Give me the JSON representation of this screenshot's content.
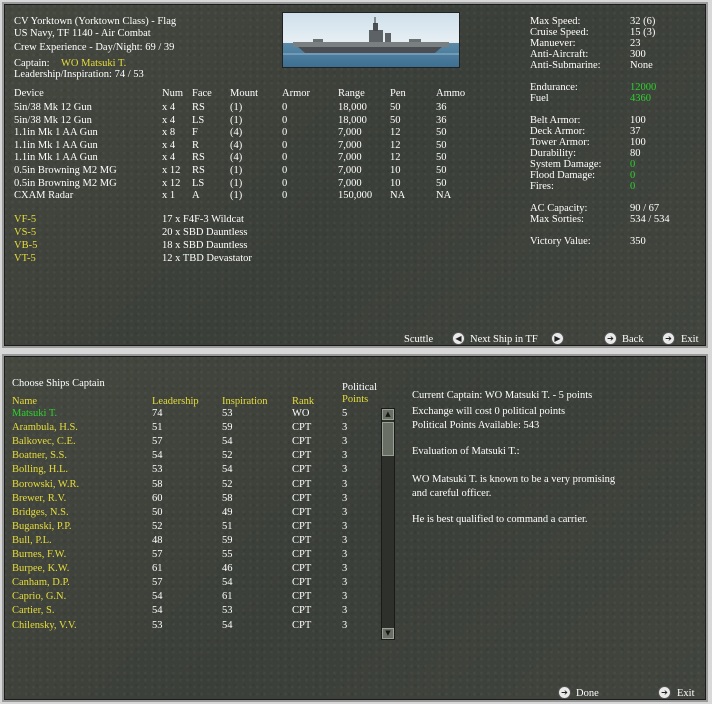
{
  "ship": {
    "title": "CV Yorktown (Yorktown Class) - Flag",
    "subtitle": "US Navy, TF 1140 - Air Combat",
    "crew_exp": "Crew Experience - Day/Night: 69 / 39",
    "captain_label": "Captain:",
    "captain_name": "WO Matsuki T.",
    "leadership": "Leadership/Inspiration: 74 / 53"
  },
  "stats": [
    {
      "label": "Max Speed:",
      "value": "32 (6)",
      "value_color": "white"
    },
    {
      "label": "Cruise Speed:",
      "value": "15 (3)",
      "value_color": "white"
    },
    {
      "label": "Manuever:",
      "value": "23",
      "value_color": "white"
    },
    {
      "label": "Anti-Aircraft:",
      "value": "300",
      "value_color": "white"
    },
    {
      "label": "Anti-Submarine:",
      "value": "None",
      "value_color": "white"
    },
    {
      "label": "Endurance:",
      "value": "12000",
      "value_color": "green"
    },
    {
      "label": "Fuel",
      "value": "4360",
      "value_color": "green"
    },
    {
      "label": "Belt Armor:",
      "value": "100",
      "value_color": "white"
    },
    {
      "label": "Deck Armor:",
      "value": "37",
      "value_color": "white"
    },
    {
      "label": "Tower Armor:",
      "value": "100",
      "value_color": "white"
    },
    {
      "label": "Durability:",
      "value": "80",
      "value_color": "white"
    },
    {
      "label": "System Damage:",
      "value": "0",
      "value_color": "green"
    },
    {
      "label": "Flood Damage:",
      "value": "0",
      "value_color": "green"
    },
    {
      "label": "Fires:",
      "value": "0",
      "value_color": "green"
    },
    {
      "label": "AC Capacity:",
      "value": "90 / 67",
      "value_color": "white"
    },
    {
      "label": "Max Sorties:",
      "value": "534 / 534",
      "value_color": "white"
    },
    {
      "label": "Victory Value:",
      "value": "350",
      "value_color": "white"
    }
  ],
  "devices_header": [
    "Device",
    "Num",
    "Face",
    "Mount",
    "Armor",
    "Range",
    "Pen",
    "Ammo"
  ],
  "devices": [
    [
      "5in/38 Mk 12 Gun",
      "x 4",
      "RS",
      "(1)",
      "0",
      "18,000",
      "50",
      "36"
    ],
    [
      "5in/38 Mk 12 Gun",
      "x 4",
      "LS",
      "(1)",
      "0",
      "18,000",
      "50",
      "36"
    ],
    [
      "1.1in Mk 1 AA Gun",
      "x 8",
      "F",
      "(4)",
      "0",
      "7,000",
      "12",
      "50"
    ],
    [
      "1.1in Mk 1 AA Gun",
      "x 4",
      "R",
      "(4)",
      "0",
      "7,000",
      "12",
      "50"
    ],
    [
      "1.1in Mk 1 AA Gun",
      "x 4",
      "RS",
      "(4)",
      "0",
      "7,000",
      "12",
      "50"
    ],
    [
      "0.5in Browning M2 MG",
      "x 12",
      "RS",
      "(1)",
      "0",
      "7,000",
      "10",
      "50"
    ],
    [
      "0.5in Browning M2 MG",
      "x 12",
      "LS",
      "(1)",
      "0",
      "7,000",
      "10",
      "50"
    ],
    [
      "CXAM Radar",
      "x 1",
      "A",
      "(1)",
      "0",
      "150,000",
      "NA",
      "NA"
    ]
  ],
  "squadrons": [
    {
      "name": "VF-5",
      "desc": "17 x F4F-3 Wildcat"
    },
    {
      "name": "VS-5",
      "desc": "20 x SBD Dauntless"
    },
    {
      "name": "VB-5",
      "desc": "18 x SBD Dauntless"
    },
    {
      "name": "VT-5",
      "desc": "12 x TBD Devastator"
    }
  ],
  "top_buttons": {
    "scuttle": "Scuttle",
    "next_ship": "Next Ship in TF",
    "back": "Back",
    "exit": "Exit"
  },
  "captains": {
    "title": "Choose Ships Captain",
    "headers": [
      "Name",
      "Leadership",
      "Inspiration",
      "Rank",
      "Political",
      "Points"
    ],
    "rows": [
      {
        "name": "Matsuki T.",
        "lead": "74",
        "insp": "53",
        "rank": "WO",
        "pts": "5",
        "current": true
      },
      {
        "name": "Arambula, H.S.",
        "lead": "51",
        "insp": "59",
        "rank": "CPT",
        "pts": "3"
      },
      {
        "name": "Balkovec, C.E.",
        "lead": "57",
        "insp": "54",
        "rank": "CPT",
        "pts": "3"
      },
      {
        "name": "Boatner, S.S.",
        "lead": "54",
        "insp": "52",
        "rank": "CPT",
        "pts": "3"
      },
      {
        "name": "Bolling, H.L.",
        "lead": "53",
        "insp": "54",
        "rank": "CPT",
        "pts": "3"
      },
      {
        "name": "Borowski, W.R.",
        "lead": "58",
        "insp": "52",
        "rank": "CPT",
        "pts": "3"
      },
      {
        "name": "Brewer, R.V.",
        "lead": "60",
        "insp": "58",
        "rank": "CPT",
        "pts": "3"
      },
      {
        "name": "Bridges, N.S.",
        "lead": "50",
        "insp": "49",
        "rank": "CPT",
        "pts": "3"
      },
      {
        "name": "Buganski, P.P.",
        "lead": "52",
        "insp": "51",
        "rank": "CPT",
        "pts": "3"
      },
      {
        "name": "Bull, P.L.",
        "lead": "48",
        "insp": "59",
        "rank": "CPT",
        "pts": "3"
      },
      {
        "name": "Burnes, F.W.",
        "lead": "57",
        "insp": "55",
        "rank": "CPT",
        "pts": "3"
      },
      {
        "name": "Burpee, K.W.",
        "lead": "61",
        "insp": "46",
        "rank": "CPT",
        "pts": "3"
      },
      {
        "name": "Canham, D.P.",
        "lead": "57",
        "insp": "54",
        "rank": "CPT",
        "pts": "3"
      },
      {
        "name": "Caprio, G.N.",
        "lead": "54",
        "insp": "61",
        "rank": "CPT",
        "pts": "3"
      },
      {
        "name": "Cartier, S.",
        "lead": "54",
        "insp": "53",
        "rank": "CPT",
        "pts": "3"
      },
      {
        "name": "Chilensky, V.V.",
        "lead": "53",
        "insp": "54",
        "rank": "CPT",
        "pts": "3"
      }
    ]
  },
  "info": {
    "current_captain": "Current Captain: WO Matsuki T. - 5 points",
    "exchange_cost": "Exchange will cost 0 political points",
    "political_points": "Political Points Available:  543",
    "evaluation_title": "Evaluation of Matsuki T.:",
    "evaluation_line1": "WO Matsuki T. is known to be a very promising",
    "evaluation_line2": "and careful officer.",
    "qualification": "He is best qualified to command a carrier."
  },
  "bottom_buttons": {
    "done": "Done",
    "exit": "Exit"
  },
  "colors": {
    "accent_yellow": "#e6dc3a",
    "status_green": "#2ed12e",
    "panel_bg": "#3f433d"
  }
}
